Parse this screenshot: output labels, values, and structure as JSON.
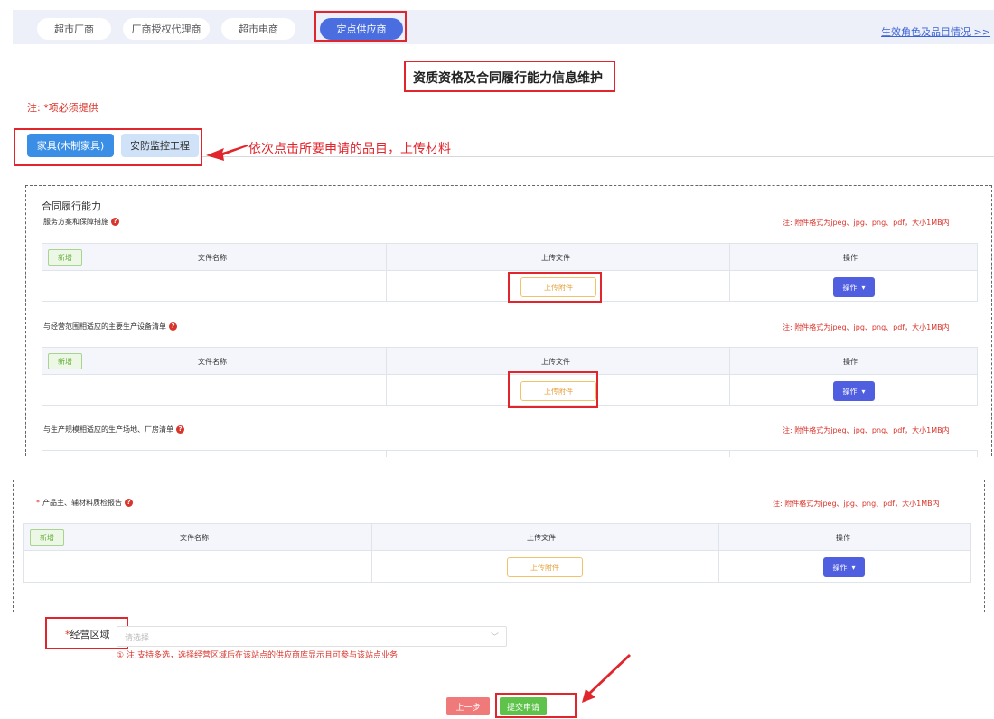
{
  "tabs": [
    {
      "label": "超市厂商"
    },
    {
      "label": "厂商授权代理商"
    },
    {
      "label": "超市电商"
    },
    {
      "label": "定点供应商"
    }
  ],
  "top_link": "生效角色及品目情况 >>",
  "page_title": "资质资格及合同履行能力信息维护",
  "required_note": "注: *项必须提供",
  "categories": [
    {
      "label": "家具(木制家具)"
    },
    {
      "label": "安防监控工程"
    }
  ],
  "annotation_text": "依次点击所要申请的品目，上传材料",
  "section_title": "合同履行能力",
  "format_note": "注: 附件格式为jpeg、jpg、png、pdf，大小1MB内",
  "uploads": [
    {
      "label": "服务方案和保障措施",
      "required": ""
    },
    {
      "label": "与经营范围相适应的主要生产设备清单",
      "required": ""
    },
    {
      "label": "与生产规模相适应的生产场地、厂房清单",
      "required": ""
    },
    {
      "label": "产品主、辅材料质检报告",
      "required": "* "
    }
  ],
  "table": {
    "add_label": "新增",
    "col_filename": "文件名称",
    "col_upload": "上传文件",
    "col_action": "操作",
    "upload_btn": "上传附件",
    "action_btn": "操作"
  },
  "region": {
    "star": "*",
    "label": "经营区域",
    "placeholder": "请选择",
    "note": "① 注:支持多选，选择经营区域后在该站点的供应商库显示且可参与该站点业务"
  },
  "buttons": {
    "prev": "上一步",
    "submit": "提交申请"
  },
  "colors": {
    "accent": "#4a6ee0",
    "annotation_red": "#e0262c",
    "upload_border": "#f0c36a",
    "action": "#4f5fe0",
    "submit": "#5fc24a",
    "prev": "#f07a7a"
  }
}
